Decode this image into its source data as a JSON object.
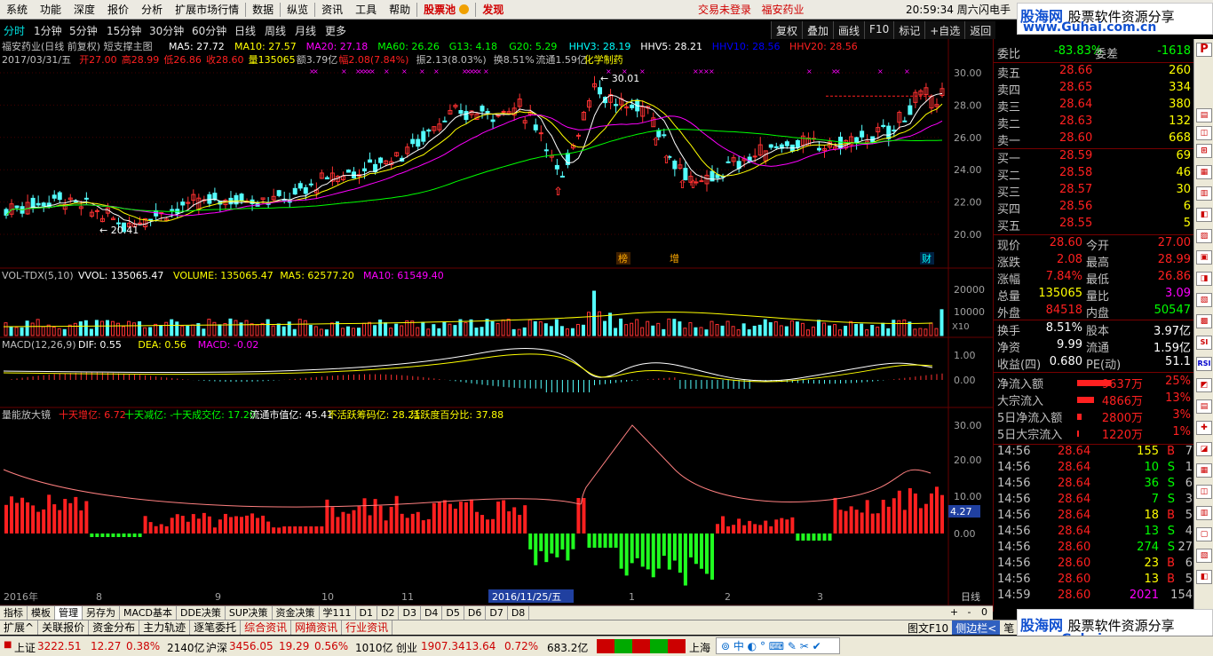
{
  "menu": {
    "items": [
      "系统",
      "功能",
      "深度",
      "报价",
      "分析",
      "扩展市场行情",
      "数据",
      "纵览",
      "资讯",
      "工具",
      "帮助"
    ],
    "stock_pool": "股票池",
    "discover": "发现",
    "login_status": "交易未登录",
    "stock_name": "福安药业",
    "time": "20:59:34",
    "weekday": "周六",
    "flash": "闪电手"
  },
  "brand": {
    "name": "股海网",
    "slogan": "股票软件资源分享",
    "url": "www.Guhai.com.cn"
  },
  "periods": [
    "分时",
    "1分钟",
    "5分钟",
    "15分钟",
    "30分钟",
    "60分钟",
    "日线",
    "周线",
    "月线",
    "更多"
  ],
  "toolbar": [
    "复权",
    "叠加",
    "画线",
    "F10",
    "标记",
    "+自选",
    "返回"
  ],
  "main": {
    "title": "福安药业(日线 前复权) 短支撑主图",
    "indicators": [
      {
        "t": "MA5: 27.72",
        "c": "#ffffff"
      },
      {
        "t": "MA10: 27.57",
        "c": "#ffff00"
      },
      {
        "t": "MA20: 27.18",
        "c": "#ff00ff"
      },
      {
        "t": "MA60: 26.26",
        "c": "#00ff00"
      },
      {
        "t": "G13: 4.18",
        "c": "#00ff00"
      },
      {
        "t": "G20: 5.29",
        "c": "#00ff00"
      },
      {
        "t": "HHV3: 28.19",
        "c": "#00ffff"
      },
      {
        "t": "HHV5: 28.21",
        "c": "#ffffff"
      },
      {
        "t": "HHV10: 28.56",
        "c": "#0000ff"
      },
      {
        "t": "HHV20: 28.56",
        "c": "#ff2020"
      }
    ],
    "info": [
      {
        "t": "2017/03/31/五",
        "c": "#c0c0c0"
      },
      {
        "t": "开27.00",
        "c": "#ff2020"
      },
      {
        "t": "高28.99",
        "c": "#ff2020"
      },
      {
        "t": "低26.86",
        "c": "#ff2020"
      },
      {
        "t": "收28.60",
        "c": "#ff2020"
      },
      {
        "t": "量135065",
        "c": "#ffff00"
      },
      {
        "t": "额3.79亿",
        "c": "#c0c0c0"
      },
      {
        "t": "幅2.08(7.84%)",
        "c": "#ff2020"
      },
      {
        "t": "振2.13(8.03%)",
        "c": "#c0c0c0"
      },
      {
        "t": "换8.51%",
        "c": "#c0c0c0"
      },
      {
        "t": "流通1.59亿",
        "c": "#c0c0c0"
      },
      {
        "t": "化学制药",
        "c": "#ffff00"
      }
    ],
    "y_ticks": [
      "30.00",
      "28.00",
      "26.00",
      "24.00",
      "22.00",
      "20.00"
    ],
    "high_label": "30.01",
    "low_label": "20.41",
    "marks": [
      "榜",
      "增",
      "财"
    ]
  },
  "vol": {
    "title": "VOL-TDX(5,10)",
    "vvol": "VVOL: 135065.47",
    "volume": "VOLUME: 135065.47",
    "ma5": "MA5: 62577.20",
    "ma10": "MA10: 61549.40",
    "y_ticks": [
      "20000",
      "10000"
    ],
    "unit": "X10"
  },
  "macd": {
    "title": "MACD(12,26,9)",
    "dif": "DIF: 0.55",
    "dea": "DEA: 0.56",
    "macd": "MACD: -0.02",
    "y_ticks": [
      "1.00",
      "0.00"
    ]
  },
  "amp": {
    "title": "量能放大镜",
    "items": [
      {
        "t": "十天增亿: 6.72",
        "c": "#ff2020"
      },
      {
        "t": "十天减亿: -",
        "c": "#00ff00"
      },
      {
        "t": "十天成交亿: 17.20",
        "c": "#00ff00"
      },
      {
        "t": "流通市值亿: 45.41",
        "c": "#ffffff"
      },
      {
        "t": "不活跃筹码亿: 28.21",
        "c": "#ffff00"
      },
      {
        "t": "活跃度百分比: 37.88",
        "c": "#ffff00"
      }
    ],
    "y_ticks": [
      "30.00",
      "20.00",
      "10.00",
      "0.00"
    ],
    "current": "4.27"
  },
  "xaxis": {
    "labels": [
      "2016年",
      "8",
      "9",
      "10",
      "11",
      "2016/11/25/五",
      "1",
      "2",
      "3"
    ],
    "period": "日线"
  },
  "tabs": [
    "指标",
    "模板",
    "管理",
    "另存为",
    "MACD基本",
    "DDE决策",
    "SUP决策",
    "资金决策",
    "学111",
    "D1",
    "D2",
    "D3",
    "D4",
    "D5",
    "D6",
    "D7",
    "D8"
  ],
  "tabs2": [
    "扩展^",
    "关联报价",
    "资金分布",
    "主力轨迹",
    "逐笔委托",
    "综合资讯",
    "网摘资讯",
    "行业资讯"
  ],
  "tabs2_right": [
    "图文F10",
    "侧边栏<",
    "笔"
  ],
  "bottom_right": [
    "+",
    "-",
    "0"
  ],
  "quote": {
    "weibi": {
      "label": "委比",
      "value": "-83.83%",
      "label2": "委差",
      "value2": "-1618"
    },
    "sells": [
      {
        "label": "卖五",
        "price": "28.66",
        "vol": "260"
      },
      {
        "label": "卖四",
        "price": "28.65",
        "vol": "334"
      },
      {
        "label": "卖三",
        "price": "28.64",
        "vol": "380"
      },
      {
        "label": "卖二",
        "price": "28.63",
        "vol": "132"
      },
      {
        "label": "卖一",
        "price": "28.60",
        "vol": "668"
      }
    ],
    "buys": [
      {
        "label": "买一",
        "price": "28.59",
        "vol": "69"
      },
      {
        "label": "买二",
        "price": "28.58",
        "vol": "46"
      },
      {
        "label": "买三",
        "price": "28.57",
        "vol": "30"
      },
      {
        "label": "买四",
        "price": "28.56",
        "vol": "6"
      },
      {
        "label": "买五",
        "price": "28.55",
        "vol": "5"
      }
    ],
    "stats": [
      {
        "l1": "现价",
        "v1": "28.60",
        "c1": "#ff2020",
        "l2": "今开",
        "v2": "27.00",
        "c2": "#ff2020"
      },
      {
        "l1": "涨跌",
        "v1": "2.08",
        "c1": "#ff2020",
        "l2": "最高",
        "v2": "28.99",
        "c2": "#ff2020"
      },
      {
        "l1": "涨幅",
        "v1": "7.84%",
        "c1": "#ff2020",
        "l2": "最低",
        "v2": "26.86",
        "c2": "#ff2020"
      },
      {
        "l1": "总量",
        "v1": "135065",
        "c1": "#ffff00",
        "l2": "量比",
        "v2": "3.09",
        "c2": "#ff00ff"
      },
      {
        "l1": "外盘",
        "v1": "84518",
        "c1": "#ff2020",
        "l2": "内盘",
        "v2": "50547",
        "c2": "#00ff00"
      }
    ],
    "stats2": [
      {
        "l1": "换手",
        "v1": "8.51%",
        "l2": "股本",
        "v2": "3.97亿"
      },
      {
        "l1": "净资",
        "v1": "9.99",
        "l2": "流通",
        "v2": "1.59亿"
      },
      {
        "l1": "收益(四)",
        "v1": "0.680",
        "l2": "PE(动)",
        "v2": "51.1"
      }
    ],
    "flows": [
      {
        "label": "净流入额",
        "amt": "9637万",
        "pct": "25%",
        "bar": 0.8
      },
      {
        "label": "大宗流入",
        "amt": "4866万",
        "pct": "13%",
        "bar": 0.4
      },
      {
        "label": "5日净流入额",
        "amt": "2800万",
        "pct": "3%",
        "bar": 0.1
      },
      {
        "label": "5日大宗流入",
        "amt": "1220万",
        "pct": "1%",
        "bar": 0.05
      }
    ],
    "ticks": [
      {
        "t": "14:56",
        "p": "28.64",
        "v": "155",
        "bs": "B",
        "n": "7"
      },
      {
        "t": "14:56",
        "p": "28.64",
        "v": "10",
        "bs": "S",
        "n": "1"
      },
      {
        "t": "14:56",
        "p": "28.64",
        "v": "36",
        "bs": "S",
        "n": "6"
      },
      {
        "t": "14:56",
        "p": "28.64",
        "v": "7",
        "bs": "S",
        "n": "3"
      },
      {
        "t": "14:56",
        "p": "28.64",
        "v": "18",
        "bs": "B",
        "n": "5"
      },
      {
        "t": "14:56",
        "p": "28.64",
        "v": "13",
        "bs": "S",
        "n": "4"
      },
      {
        "t": "14:56",
        "p": "28.60",
        "v": "274",
        "bs": "S",
        "n": "27"
      },
      {
        "t": "14:56",
        "p": "28.60",
        "v": "23",
        "bs": "B",
        "n": "6"
      },
      {
        "t": "14:56",
        "p": "28.60",
        "v": "13",
        "bs": "B",
        "n": "5"
      },
      {
        "t": "14:59",
        "p": "28.60",
        "v": "2021",
        "bs": "",
        "n": "154"
      }
    ]
  },
  "indices": {
    "sh_label": "上证",
    "sh_val": "3222.51",
    "sh_chg": "12.27",
    "sh_pct": "0.38%",
    "sh_amt": "2140亿",
    "hs_label": "沪深",
    "hs_val": "3456.05",
    "hs_chg": "19.29",
    "hs_pct": "0.56%",
    "hs_amt": "1010亿",
    "cy_label": "创业",
    "cy_val": "1907.34",
    "cy_chg": "13.64",
    "cy_pct": "0.72%",
    "cy_amt": "683.2亿",
    "loc": "上海"
  },
  "side_tools": [
    "P",
    "SI",
    "RSI"
  ]
}
